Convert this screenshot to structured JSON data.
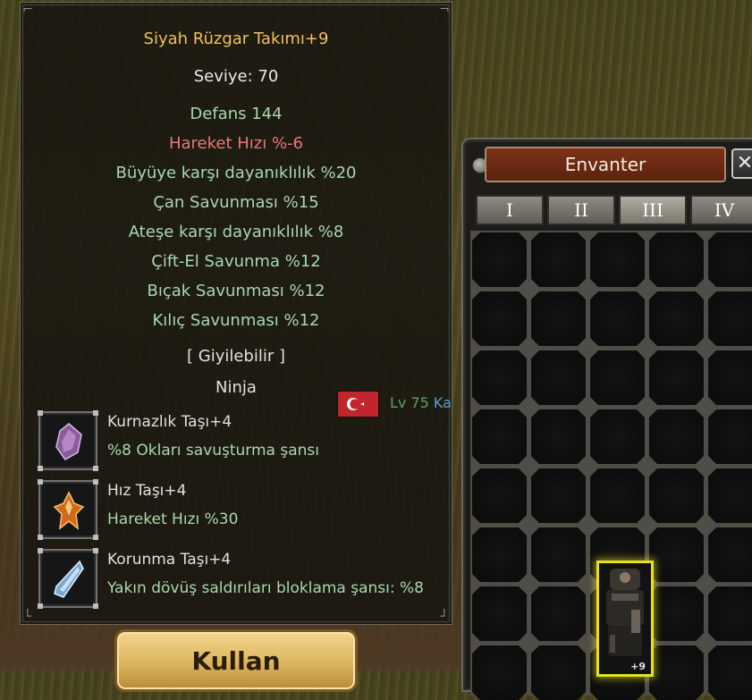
{
  "tooltip": {
    "title": "Siyah Rüzgar Takımı+9",
    "level": "Seviye: 70",
    "stats": [
      "Defans 144",
      "Hareket Hızı %-6",
      "Büyüye karşı dayanıklılık %20",
      "Çan Savunması %15",
      "Ateşe karşı dayanıklılık %8",
      "Çift-El Savunma %12",
      "Bıçak Savunması %12",
      "Kılıç Savunması %12"
    ],
    "wearable": "[ Giyilebilir ]",
    "class": "Ninja",
    "gems": [
      {
        "name": "Kurnazlık Taşı+4",
        "desc": "%8 Okları savuşturma şansı",
        "icon": "dexterity-stone-icon",
        "color": "#a070b0"
      },
      {
        "name": "Hız Taşı+4",
        "desc": "Hareket Hızı %30",
        "icon": "speed-stone-icon",
        "color": "#e07820"
      },
      {
        "name": "Korunma Taşı+4",
        "desc": "Yakın dövüş saldırıları bloklama şansı: %8",
        "icon": "protection-stone-icon",
        "color": "#a0c8e8"
      }
    ]
  },
  "nameplate": {
    "level_text": "Lv 75",
    "name_fragment": "Ka"
  },
  "use_button": {
    "label": "Kullan"
  },
  "inventory": {
    "title": "Envanter",
    "close_label": "✕",
    "tabs": [
      "I",
      "II",
      "III",
      "IV"
    ],
    "active_tab": "III",
    "item": {
      "plus": "+9",
      "highlight_color": "#e8e020"
    }
  }
}
